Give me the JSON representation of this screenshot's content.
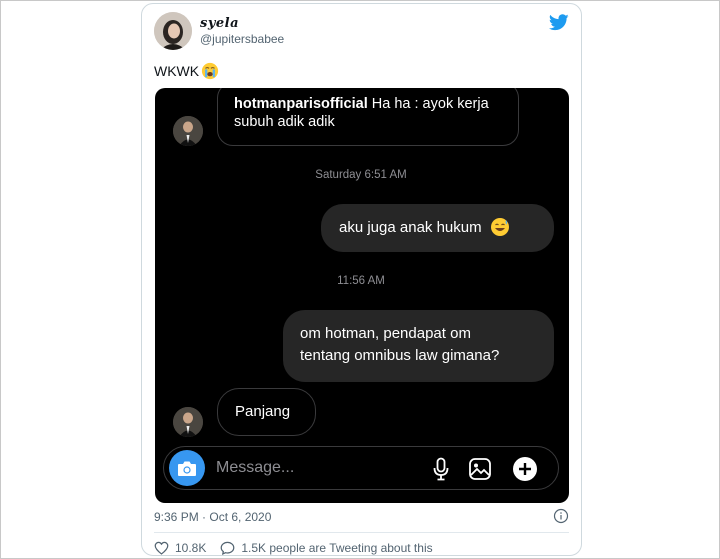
{
  "tweet": {
    "display_name": "syela",
    "handle": "@jupitersbabee",
    "text": "WKWK",
    "text_emoji": "loudly-crying-face-emoji",
    "timestamp": "9:36 PM · Oct 6, 2020",
    "likes": "10.8K",
    "retweets_text": "1.5K people are Tweeting about this"
  },
  "chat": {
    "quoted_sender": "hotmanparisofficial",
    "quoted_text": "Ha ha : ayok kerja subuh adik adik",
    "timestamp_1": "Saturday 6:51 AM",
    "sent_1": "aku juga anak hukum",
    "sent_1_emoji": "grinning-sweat-emoji",
    "timestamp_2": "11:56 AM",
    "sent_2_line1": "om hotman, pendapat om",
    "sent_2_line2": "tentang omnibus law gimana?",
    "received_1": "Panjang",
    "composer_placeholder": "Message..."
  },
  "colors": {
    "twitter_blue": "#1d9bf0",
    "instagram_blue": "#3797f0",
    "chat_background": "#000000",
    "sent_bubble": "#262626"
  },
  "icons": [
    "twitter-logo-icon",
    "camera-icon",
    "microphone-icon",
    "gallery-icon",
    "add-icon",
    "info-icon",
    "heart-icon",
    "comment-icon"
  ]
}
